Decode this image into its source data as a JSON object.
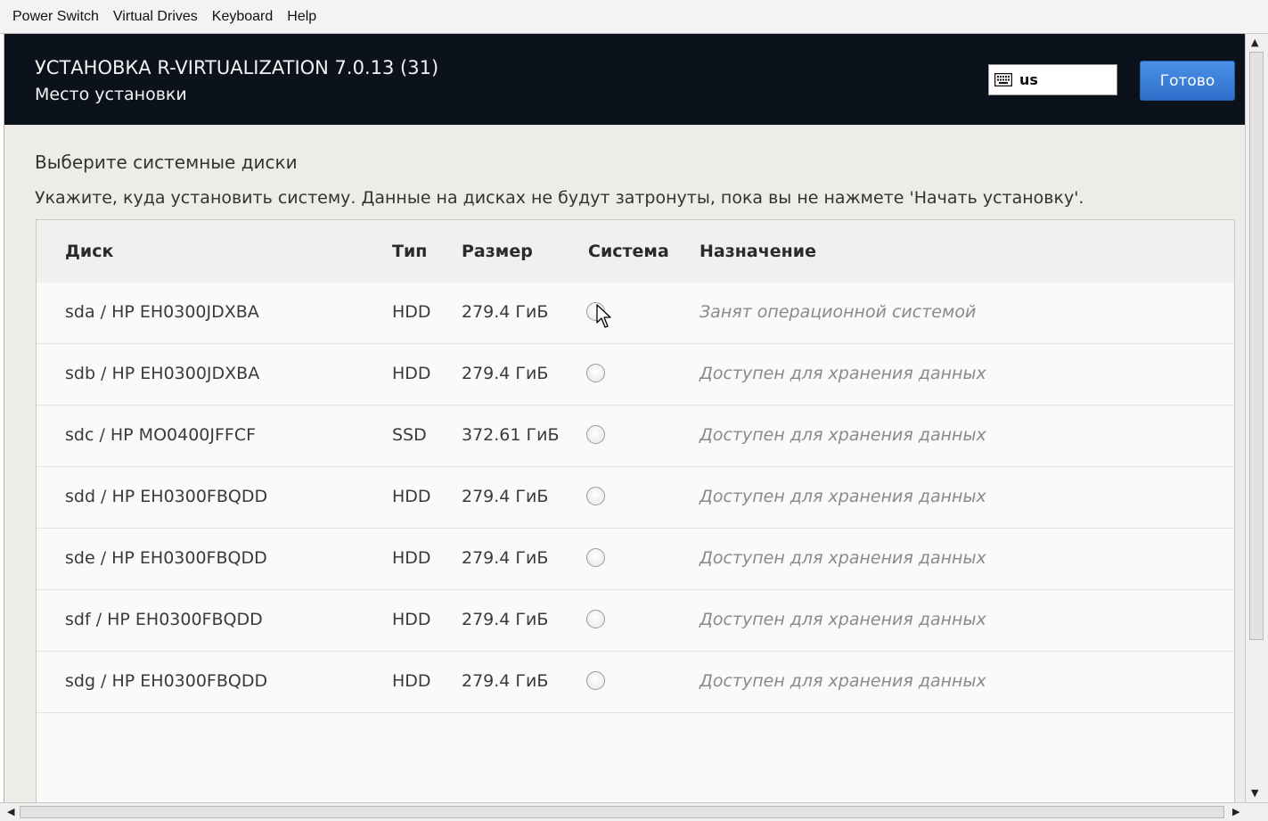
{
  "menu": [
    "Power Switch",
    "Virtual Drives",
    "Keyboard",
    "Help"
  ],
  "header": {
    "title": "УСТАНОВКА R-VIRTUALIZATION 7.0.13 (31)",
    "subtitle": "Место установки",
    "keyboard_layout": "us",
    "done_label": "Готово"
  },
  "section": {
    "title": "Выберите системные диски",
    "description": "Укажите, куда установить систему. Данные на дисках не будут затронуты, пока вы не нажмете 'Начать установку'."
  },
  "table": {
    "columns": [
      "Диск",
      "Тип",
      "Размер",
      "Система",
      "Назначение"
    ],
    "rows": [
      {
        "disk": "sda / HP EH0300JDXBA",
        "type": "HDD",
        "size": "279.4 ГиБ",
        "system": false,
        "purpose": "Занят операционной системой"
      },
      {
        "disk": "sdb / HP EH0300JDXBA",
        "type": "HDD",
        "size": "279.4 ГиБ",
        "system": false,
        "purpose": "Доступен для хранения данных"
      },
      {
        "disk": "sdc / HP MO0400JFFCF",
        "type": "SSD",
        "size": "372.61 ГиБ",
        "system": false,
        "purpose": "Доступен для хранения данных"
      },
      {
        "disk": "sdd / HP EH0300FBQDD",
        "type": "HDD",
        "size": "279.4 ГиБ",
        "system": false,
        "purpose": "Доступен для хранения данных"
      },
      {
        "disk": "sde / HP EH0300FBQDD",
        "type": "HDD",
        "size": "279.4 ГиБ",
        "system": false,
        "purpose": "Доступен для хранения данных"
      },
      {
        "disk": "sdf / HP EH0300FBQDD",
        "type": "HDD",
        "size": "279.4 ГиБ",
        "system": false,
        "purpose": "Доступен для хранения данных"
      },
      {
        "disk": "sdg / HP EH0300FBQDD",
        "type": "HDD",
        "size": "279.4 ГиБ",
        "system": false,
        "purpose": "Доступен для хранения данных"
      }
    ]
  },
  "colors": {
    "header_bg": "#0b121b",
    "accent": "#3b7fd9",
    "content_bg": "#edece6"
  },
  "icons": [
    "keyboard-icon",
    "mouse-cursor-icon",
    "scroll-up-icon",
    "scroll-down-icon",
    "scroll-left-icon",
    "scroll-right-icon"
  ]
}
